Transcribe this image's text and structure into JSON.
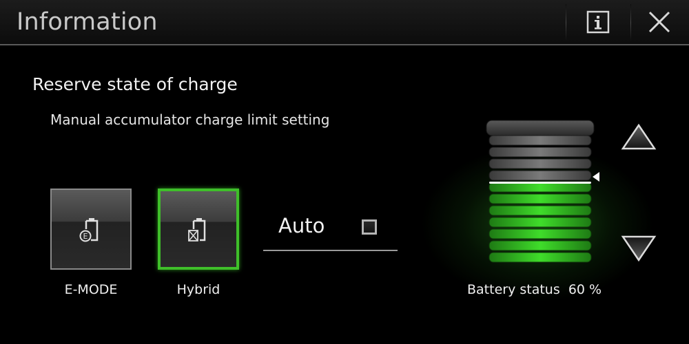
{
  "header": {
    "title": "Information",
    "info_icon": "info-icon",
    "close_icon": "close-icon"
  },
  "section": {
    "title": "Reserve state of charge",
    "subtitle": "Manual accumulator charge limit setting"
  },
  "modes": [
    {
      "label": "E-MODE",
      "icon": "battery-e-icon",
      "selected": false
    },
    {
      "label": "Hybrid",
      "icon": "battery-hybrid-icon",
      "selected": true
    }
  ],
  "auto": {
    "label": "Auto",
    "checked": false
  },
  "battery": {
    "status_label": "Battery status",
    "status_value": "60 %",
    "charge_level": 0.6,
    "segments": 11,
    "accent_color": "#3fdc2a"
  },
  "controls": {
    "up_icon": "triangle-up-icon",
    "down_icon": "triangle-down-icon"
  }
}
